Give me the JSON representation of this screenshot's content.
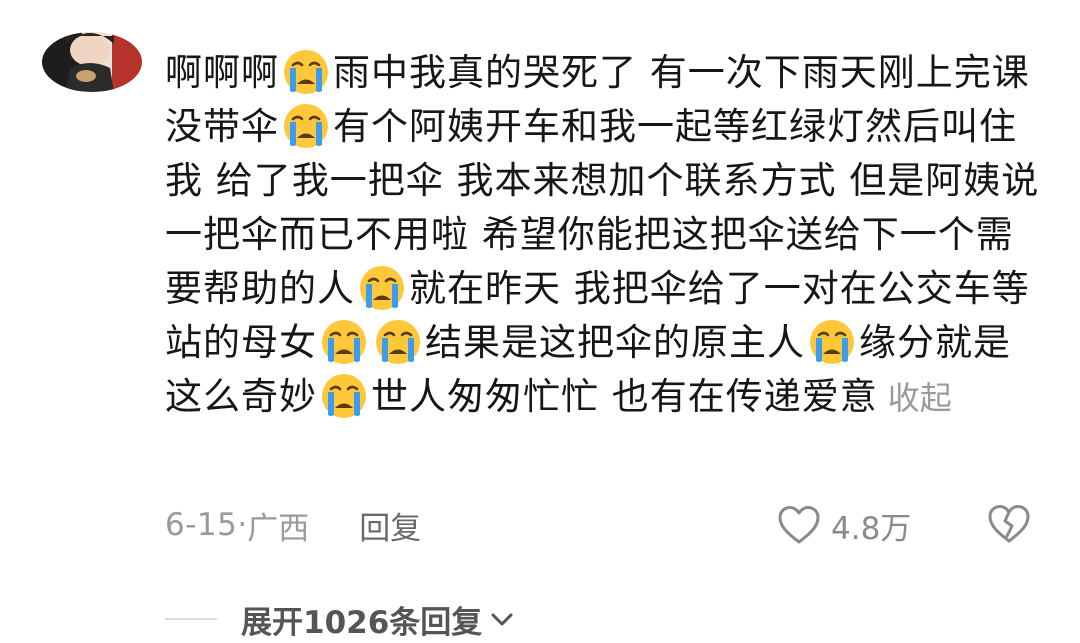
{
  "comment": {
    "avatar_icon": "user-avatar",
    "segments": [
      {
        "type": "text",
        "value": "啊啊啊"
      },
      {
        "type": "emoji",
        "value": "crying-face-emoji"
      },
      {
        "type": "text",
        "value": "雨中我真的哭死了 有一次下雨天刚上完课没带伞"
      },
      {
        "type": "emoji",
        "value": "crying-face-emoji"
      },
      {
        "type": "text",
        "value": "有个阿姨开车和我一起等红绿灯然后叫住我 给了我一把伞 我本来想加个联系方式 但是阿姨说一把伞而已不用啦 希望你能把这把伞送给下一个需要帮助的人"
      },
      {
        "type": "emoji",
        "value": "crying-face-emoji"
      },
      {
        "type": "text",
        "value": "就在昨天 我把伞给了一对在公交车等站的母女"
      },
      {
        "type": "emoji",
        "value": "crying-face-emoji"
      },
      {
        "type": "emoji",
        "value": "crying-face-emoji"
      },
      {
        "type": "text",
        "value": "结果是这把伞的原主人"
      },
      {
        "type": "emoji",
        "value": "crying-face-emoji"
      },
      {
        "type": "text",
        "value": "缘分就是这么奇妙"
      },
      {
        "type": "emoji",
        "value": "crying-face-emoji"
      },
      {
        "type": "text",
        "value": "世人匆匆忙忙 也有在传递爱意"
      }
    ],
    "collapse_label": "收起",
    "date": "6-15",
    "separator": "·",
    "location": "广西",
    "reply_label": "回复",
    "like_icon": "heart-outline-icon",
    "like_count": "4.8万",
    "dislike_icon": "broken-heart-icon",
    "expand_replies_label": "展开1026条回复",
    "expand_icon": "chevron-down-icon"
  },
  "colors": {
    "text": "#161616",
    "muted": "#9a9a9a",
    "emoji_face": "#ffc83a",
    "emoji_tear": "#3b9cf0"
  }
}
